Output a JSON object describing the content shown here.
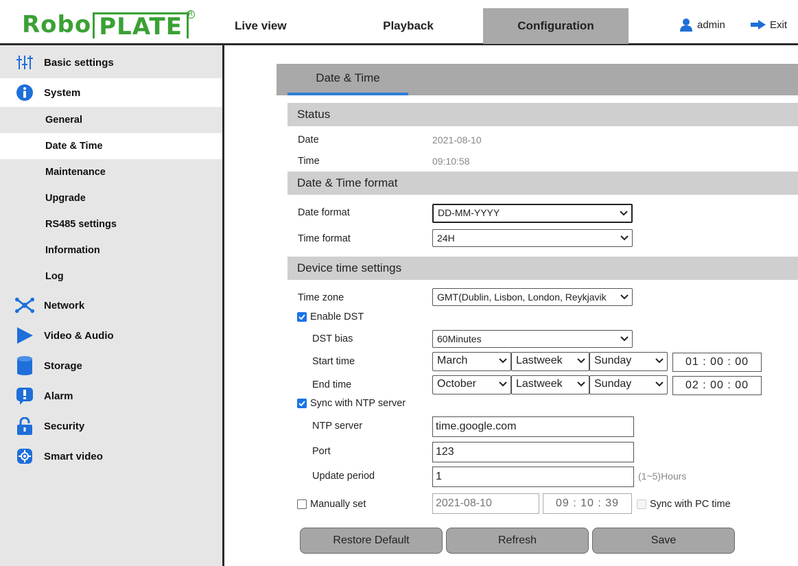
{
  "brand": {
    "logo_left": "Robo",
    "logo_right": "PLATE"
  },
  "topnav": {
    "live": "Live view",
    "playback": "Playback",
    "config": "Configuration",
    "user": "admin",
    "exit": "Exit"
  },
  "sidebar": {
    "basic": "Basic settings",
    "system": "System",
    "sub": [
      "General",
      "Date & Time",
      "Maintenance",
      "Upgrade",
      "RS485 settings",
      "Information",
      "Log"
    ],
    "network": "Network",
    "video": "Video & Audio",
    "storage": "Storage",
    "alarm": "Alarm",
    "security": "Security",
    "smart": "Smart video"
  },
  "tab": "Date & Time",
  "status": {
    "title": "Status",
    "date_label": "Date",
    "date_value": "2021-08-10",
    "time_label": "Time",
    "time_value": "09:10:58"
  },
  "format": {
    "title": "Date & Time format",
    "date_label": "Date format",
    "date_value": "DD-MM-YYYY",
    "time_label": "Time format",
    "time_value": "24H"
  },
  "device": {
    "title": "Device time settings",
    "tz_label": "Time zone",
    "tz_value": "GMT(Dublin, Lisbon, London, Reykjavik",
    "dst_label": "Enable DST",
    "bias_label": "DST bias",
    "bias_value": "60Minutes",
    "start_label": "Start time",
    "start_month": "March",
    "start_week": "Lastweek",
    "start_day": "Sunday",
    "start_time": "01 : 00 : 00",
    "end_label": "End time",
    "end_month": "October",
    "end_week": "Lastweek",
    "end_day": "Sunday",
    "end_time": "02 : 00 : 00",
    "ntp_check": "Sync with NTP server",
    "ntp_label": "NTP server",
    "ntp_value": "time.google.com",
    "port_label": "Port",
    "port_value": "123",
    "period_label": "Update period",
    "period_value": "1",
    "period_hint": "(1~5)Hours",
    "manual_label": "Manually set",
    "manual_date": "2021-08-10",
    "manual_time": "09 : 10 : 39",
    "pc_label": "Sync with PC time"
  },
  "buttons": {
    "restore": "Restore Default",
    "refresh": "Refresh",
    "save": "Save"
  },
  "colors": {
    "brand_green": "#3aa135",
    "tab_accent": "#2f7fd6",
    "check_blue": "#1a73e8",
    "icon_blue": "#1e6fd9"
  }
}
